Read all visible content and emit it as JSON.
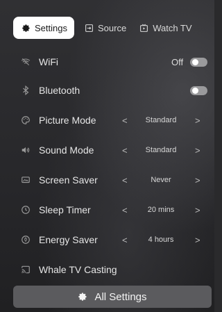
{
  "tabs": [
    {
      "label": "Settings",
      "icon": "gear-icon",
      "active": true
    },
    {
      "label": "Source",
      "icon": "input-source-icon",
      "active": false
    },
    {
      "label": "Watch TV",
      "icon": "tv-icon",
      "active": false
    }
  ],
  "rows": [
    {
      "label": "WiFi",
      "icon": "wifi-icon",
      "type": "toggle",
      "value": "Off"
    },
    {
      "label": "Bluetooth",
      "icon": "bluetooth-icon",
      "type": "toggle",
      "value": ""
    },
    {
      "label": "Picture Mode",
      "icon": "palette-icon",
      "type": "selector",
      "value": "Standard"
    },
    {
      "label": "Sound Mode",
      "icon": "speaker-icon",
      "type": "selector",
      "value": "Standard"
    },
    {
      "label": "Screen Saver",
      "icon": "screen-saver-icon",
      "type": "selector",
      "value": "Never"
    },
    {
      "label": "Sleep Timer",
      "icon": "clock-icon",
      "type": "selector",
      "value": "20 mins"
    },
    {
      "label": "Energy Saver",
      "icon": "leaf-icon",
      "type": "selector",
      "value": "4 hours"
    },
    {
      "label": "Whale TV Casting",
      "icon": "cast-icon",
      "type": "link",
      "value": ""
    }
  ],
  "footer": {
    "label": "All Settings",
    "icon": "gear-icon"
  },
  "glyphs": {
    "prev": "<",
    "next": ">"
  },
  "colors": {
    "background": "#2a2a2c",
    "active_tab": "#ffffff",
    "button": "#5b5b5e",
    "toggle_off": "#9a9a9c"
  }
}
